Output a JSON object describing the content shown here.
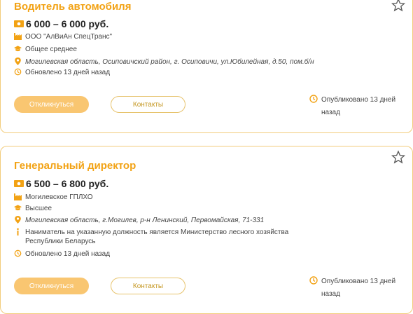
{
  "colors": {
    "accent": "#f2a214",
    "button_fill": "#f9c671",
    "card_border": "#f2cc7a",
    "icon": "#f2a214"
  },
  "vacancies": [
    {
      "title": "Водитель автомобиля",
      "salary": "6 000 – 6 000 руб.",
      "company": "ООО \"АлВиАн СпецТранс\"",
      "education": "Общее среднее",
      "address": "Могилевская область, Осиповичский район, г. Осиповичи, ул.Юбилейная, д.50, пом.б/н",
      "updated": "Обновлено 13 дней назад",
      "apply_label": "Откликнуться",
      "contacts_label": "Контакты",
      "published": "Опубликовано 13 дней назад"
    },
    {
      "title": "Генеральный директор",
      "salary": "6 500 – 6 800 руб.",
      "company": "Могилевское ГПЛХО",
      "education": "Высшее",
      "address": "Могилевская область, г.Могилев, р-н Ленинский, Первомайская, 71-331",
      "note": "Наниматель на указанную должность является Министерство лесного хозяйства Республики Беларусь",
      "updated": "Обновлено 13 дней назад",
      "apply_label": "Откликнуться",
      "contacts_label": "Контакты",
      "published": "Опубликовано 13 дней назад"
    }
  ]
}
